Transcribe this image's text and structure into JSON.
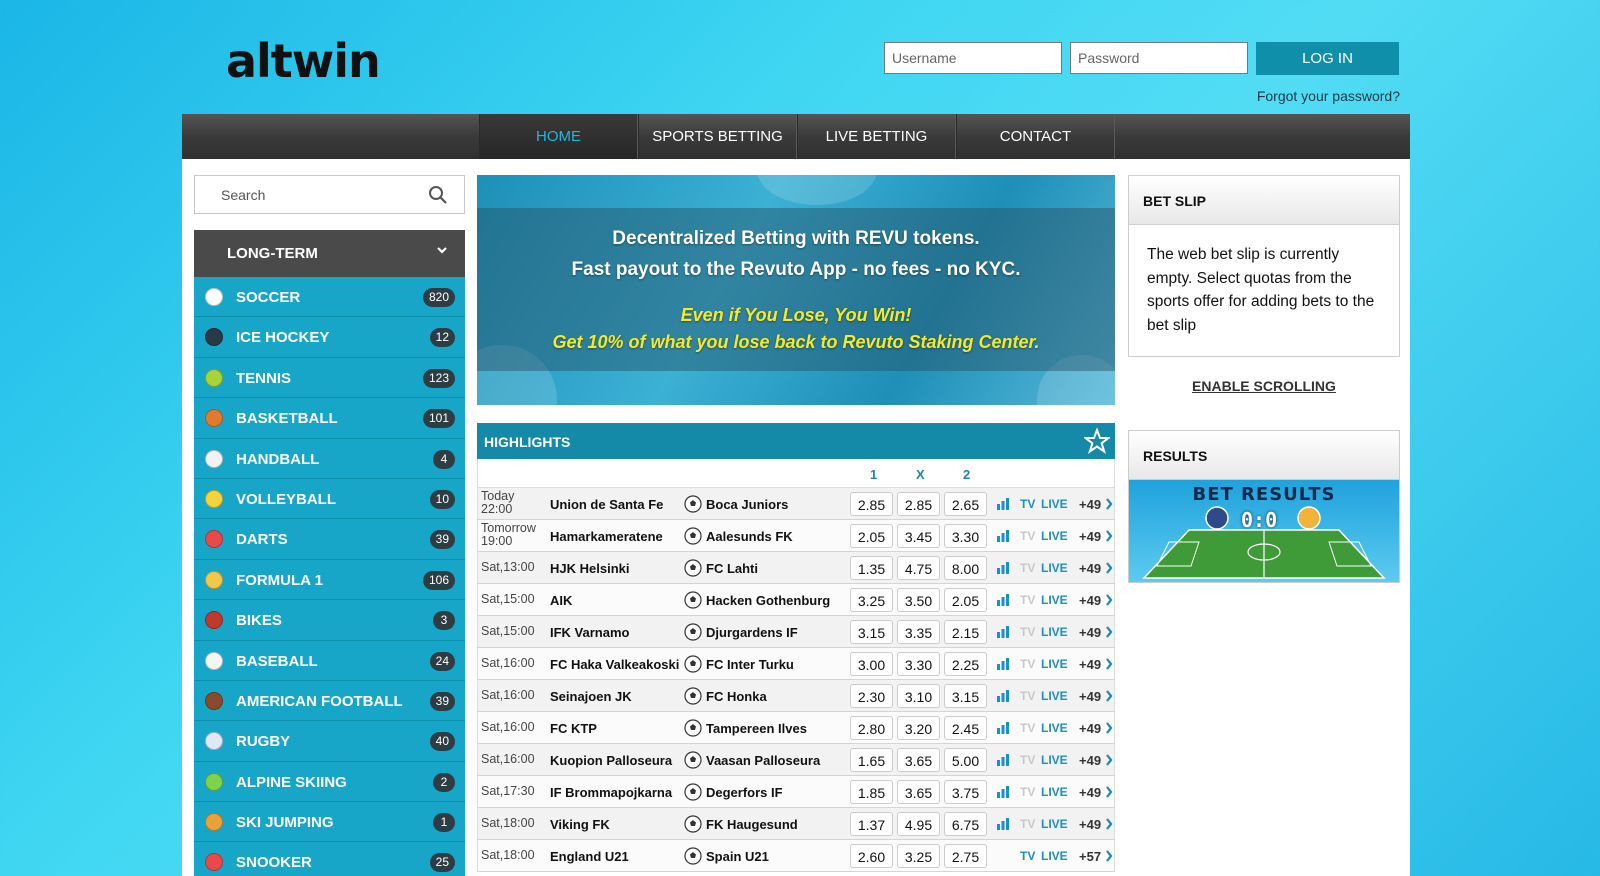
{
  "brand": {
    "logo": "altwin"
  },
  "login": {
    "username_placeholder": "Username",
    "password_placeholder": "Password",
    "login_label": "LOG IN",
    "forgot_label": "Forgot your password?"
  },
  "nav": {
    "items": [
      {
        "label": "HOME",
        "active": true
      },
      {
        "label": "SPORTS BETTING",
        "active": false
      },
      {
        "label": "LIVE BETTING",
        "active": false
      },
      {
        "label": "CONTACT",
        "active": false
      }
    ]
  },
  "sidebar": {
    "search_placeholder": "Search",
    "section_label": "LONG-TERM",
    "sports": [
      {
        "name": "SOCCER",
        "count": "820",
        "icon": "soccer-ball-icon",
        "color": "#ffffff"
      },
      {
        "name": "ICE HOCKEY",
        "count": "12",
        "icon": "hockey-puck-icon",
        "color": "#2a3a44"
      },
      {
        "name": "TENNIS",
        "count": "123",
        "icon": "tennis-ball-icon",
        "color": "#a7d43a"
      },
      {
        "name": "BASKETBALL",
        "count": "101",
        "icon": "basketball-icon",
        "color": "#e07a2c"
      },
      {
        "name": "HANDBALL",
        "count": "4",
        "icon": "handball-icon",
        "color": "#f2f2f2"
      },
      {
        "name": "VOLLEYBALL",
        "count": "10",
        "icon": "volleyball-icon",
        "color": "#f5d33b"
      },
      {
        "name": "DARTS",
        "count": "39",
        "icon": "dartboard-icon",
        "color": "#e84a4a"
      },
      {
        "name": "FORMULA 1",
        "count": "106",
        "icon": "helmet-icon",
        "color": "#f1c84a"
      },
      {
        "name": "BIKES",
        "count": "3",
        "icon": "motorbike-helmet-icon",
        "color": "#c0392b"
      },
      {
        "name": "BASEBALL",
        "count": "24",
        "icon": "baseball-icon",
        "color": "#f5f5f5"
      },
      {
        "name": "AMERICAN FOOTBALL",
        "count": "39",
        "icon": "american-football-icon",
        "color": "#8b4a2b"
      },
      {
        "name": "RUGBY",
        "count": "40",
        "icon": "rugby-ball-icon",
        "color": "#dfe9f5"
      },
      {
        "name": "ALPINE SKIING",
        "count": "2",
        "icon": "skiing-icon",
        "color": "#7fd34a"
      },
      {
        "name": "SKI JUMPING",
        "count": "1",
        "icon": "ski-jumping-icon",
        "color": "#e8a23a"
      },
      {
        "name": "SNOOKER",
        "count": "25",
        "icon": "snooker-icon",
        "color": "#e84a4a"
      }
    ]
  },
  "banner": {
    "line1": "Decentralized Betting with REVU tokens.",
    "line2": "Fast payout to the Revuto App - no fees - no KYC.",
    "line3": "Even if You Lose, You Win!",
    "line4": "Get 10% of what you lose back to Revuto Staking Center."
  },
  "highlights": {
    "title": "HIGHLIGHTS",
    "col1": "1",
    "colx": "X",
    "col2": "2",
    "matches": [
      {
        "time": "Today\n22:00",
        "home": "Union de Santa Fe",
        "away": "Boca Juniors",
        "o1": "2.85",
        "ox": "2.85",
        "o2": "2.65",
        "tv": "TV",
        "tv_active": true,
        "live": "LIVE",
        "more": "+49",
        "stats": true
      },
      {
        "time": "Tomorrow\n19:00",
        "home": "Hamarkameratene",
        "away": "Aalesunds FK",
        "o1": "2.05",
        "ox": "3.45",
        "o2": "3.30",
        "tv": "TV",
        "tv_active": false,
        "live": "LIVE",
        "more": "+49",
        "stats": true
      },
      {
        "time": "Sat,13:00",
        "home": "HJK Helsinki",
        "away": "FC Lahti",
        "o1": "1.35",
        "ox": "4.75",
        "o2": "8.00",
        "tv": "TV",
        "tv_active": false,
        "live": "LIVE",
        "more": "+49",
        "stats": true
      },
      {
        "time": "Sat,15:00",
        "home": "AIK",
        "away": "Hacken Gothenburg",
        "o1": "3.25",
        "ox": "3.50",
        "o2": "2.05",
        "tv": "TV",
        "tv_active": false,
        "live": "LIVE",
        "more": "+49",
        "stats": true
      },
      {
        "time": "Sat,15:00",
        "home": "IFK Varnamo",
        "away": "Djurgardens IF",
        "o1": "3.15",
        "ox": "3.35",
        "o2": "2.15",
        "tv": "TV",
        "tv_active": false,
        "live": "LIVE",
        "more": "+49",
        "stats": true
      },
      {
        "time": "Sat,16:00",
        "home": "FC Haka Valkeakoski",
        "away": "FC Inter Turku",
        "o1": "3.00",
        "ox": "3.30",
        "o2": "2.25",
        "tv": "TV",
        "tv_active": false,
        "live": "LIVE",
        "more": "+49",
        "stats": true
      },
      {
        "time": "Sat,16:00",
        "home": "Seinajoen JK",
        "away": "FC Honka",
        "o1": "2.30",
        "ox": "3.10",
        "o2": "3.15",
        "tv": "TV",
        "tv_active": false,
        "live": "LIVE",
        "more": "+49",
        "stats": true
      },
      {
        "time": "Sat,16:00",
        "home": "FC KTP",
        "away": "Tampereen Ilves",
        "o1": "2.80",
        "ox": "3.20",
        "o2": "2.45",
        "tv": "TV",
        "tv_active": false,
        "live": "LIVE",
        "more": "+49",
        "stats": true
      },
      {
        "time": "Sat,16:00",
        "home": "Kuopion Palloseura",
        "away": "Vaasan Palloseura",
        "o1": "1.65",
        "ox": "3.65",
        "o2": "5.00",
        "tv": "TV",
        "tv_active": false,
        "live": "LIVE",
        "more": "+49",
        "stats": true
      },
      {
        "time": "Sat,17:30",
        "home": "IF Brommapojkarna",
        "away": "Degerfors IF",
        "o1": "1.85",
        "ox": "3.65",
        "o2": "3.75",
        "tv": "TV",
        "tv_active": false,
        "live": "LIVE",
        "more": "+49",
        "stats": true
      },
      {
        "time": "Sat,18:00",
        "home": "Viking FK",
        "away": "FK Haugesund",
        "o1": "1.37",
        "ox": "4.95",
        "o2": "6.75",
        "tv": "TV",
        "tv_active": false,
        "live": "LIVE",
        "more": "+49",
        "stats": true
      },
      {
        "time": "Sat,18:00",
        "home": "England U21",
        "away": "Spain U21",
        "o1": "2.60",
        "ox": "3.25",
        "o2": "2.75",
        "tv": "TV",
        "tv_active": true,
        "live": "LIVE",
        "more": "+57",
        "stats": false
      }
    ]
  },
  "betslip": {
    "title": "BET SLIP",
    "message": "The web bet slip is currently empty. Select quotas from the sports offer for adding bets to the bet slip",
    "enable_scrolling": "ENABLE SCROLLING"
  },
  "results": {
    "title": "RESULTS",
    "image_title": "BET RESULTS",
    "image_score": "0:0"
  },
  "colors": {
    "accent": "#148aa8",
    "sidebar": "#17a6c8",
    "nav": "#3a3a3a",
    "highlight_active": "#24b6dc"
  }
}
